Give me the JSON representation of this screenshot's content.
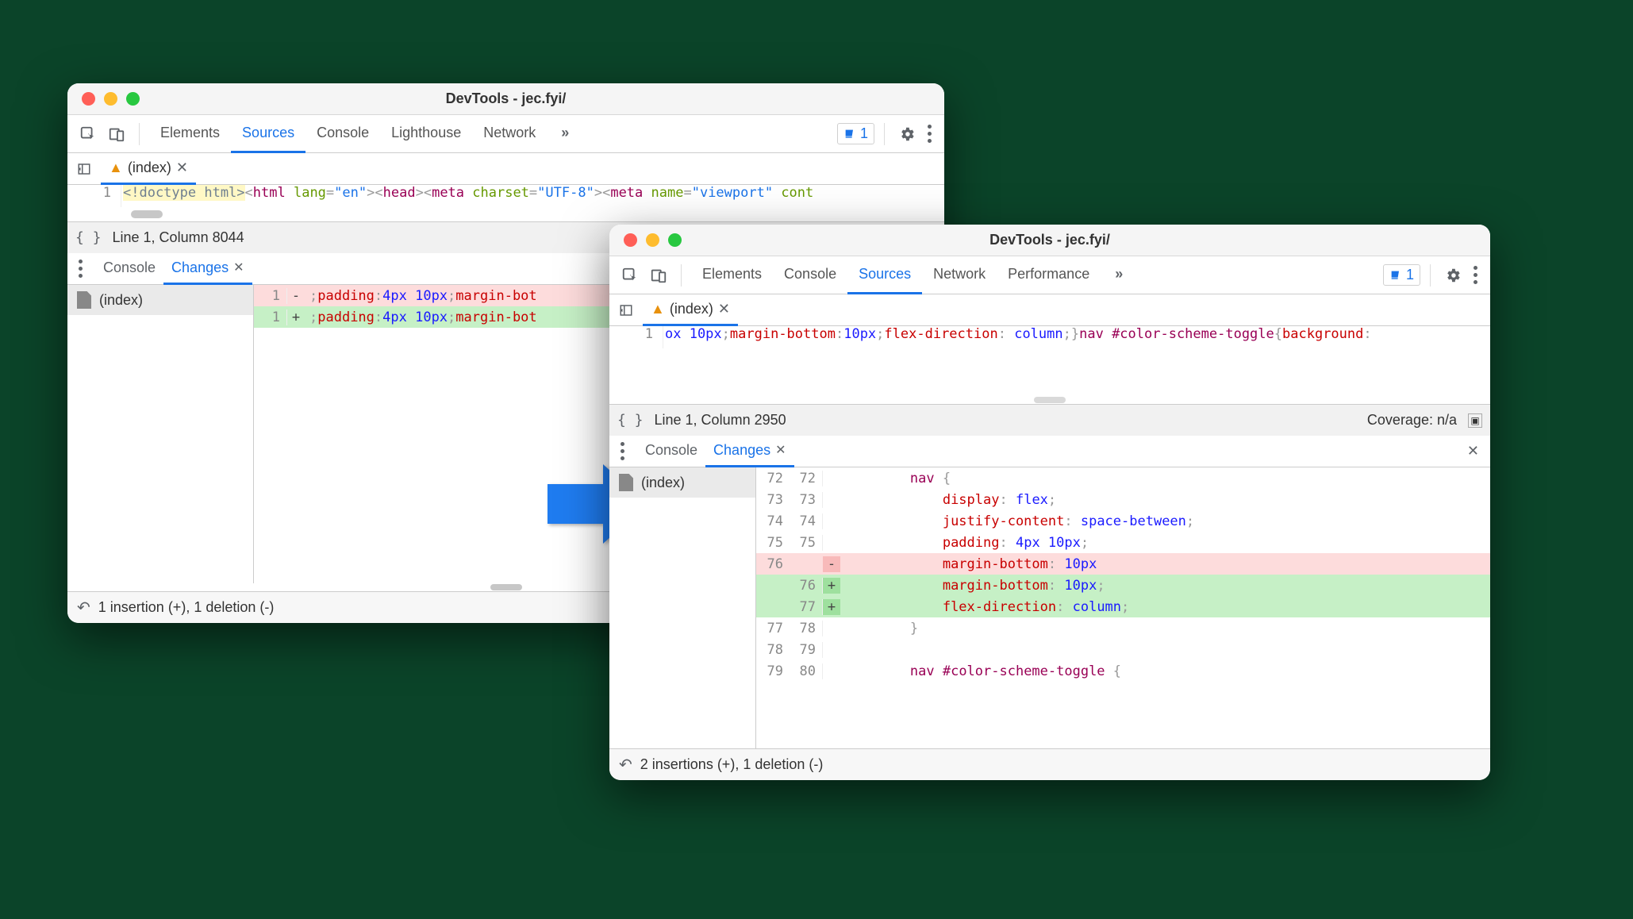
{
  "arrow_color": "#1f7cf0",
  "win1": {
    "title": "DevTools - jec.fyi/",
    "tabs": [
      "Elements",
      "Sources",
      "Console",
      "Lighthouse",
      "Network"
    ],
    "active_tab": 1,
    "more_glyph": "»",
    "issues_count": "1",
    "file_tab": "(index)",
    "code_line_num": "1",
    "code_tokens": [
      {
        "t": "<!doctype html>",
        "cls": "token-doctype hl-yellow"
      },
      {
        "t": "<",
        "cls": "token-punct"
      },
      {
        "t": "html",
        "cls": "token-tag"
      },
      {
        "t": " lang",
        "cls": "token-attrname"
      },
      {
        "t": "=",
        "cls": "token-punct"
      },
      {
        "t": "\"en\"",
        "cls": "token-string"
      },
      {
        "t": ">",
        "cls": "token-punct"
      },
      {
        "t": "<",
        "cls": "token-punct"
      },
      {
        "t": "head",
        "cls": "token-tag"
      },
      {
        "t": ">",
        "cls": "token-punct"
      },
      {
        "t": "<",
        "cls": "token-punct"
      },
      {
        "t": "meta",
        "cls": "token-tag"
      },
      {
        "t": " charset",
        "cls": "token-attrname"
      },
      {
        "t": "=",
        "cls": "token-punct"
      },
      {
        "t": "\"UTF-8\"",
        "cls": "token-string"
      },
      {
        "t": ">",
        "cls": "token-punct"
      },
      {
        "t": "<",
        "cls": "token-punct"
      },
      {
        "t": "meta",
        "cls": "token-tag"
      },
      {
        "t": " name",
        "cls": "token-attrname"
      },
      {
        "t": "=",
        "cls": "token-punct"
      },
      {
        "t": "\"viewport\"",
        "cls": "token-string"
      },
      {
        "t": " cont",
        "cls": "token-attrname"
      }
    ],
    "status": "Line 1, Column 8044",
    "drawer_tabs": [
      "Console",
      "Changes"
    ],
    "drawer_active": 1,
    "changes_file": "(index)",
    "diff": [
      {
        "oldln": "1",
        "newln": "",
        "sign": "-",
        "kind": "del",
        "segs": [
          {
            "t": ";",
            "cls": "token-punct"
          },
          {
            "t": "padding",
            "cls": "token-prop"
          },
          {
            "t": ":",
            "cls": "token-punct"
          },
          {
            "t": "4px 10px",
            "cls": "token-num"
          },
          {
            "t": ";",
            "cls": "token-punct"
          },
          {
            "t": "margin-bot",
            "cls": "token-prop"
          }
        ]
      },
      {
        "oldln": "",
        "newln": "1",
        "sign": "+",
        "kind": "add",
        "segs": [
          {
            "t": ";",
            "cls": "token-punct"
          },
          {
            "t": "padding",
            "cls": "token-prop"
          },
          {
            "t": ":",
            "cls": "token-punct"
          },
          {
            "t": "4px 10px",
            "cls": "token-num"
          },
          {
            "t": ";",
            "cls": "token-punct"
          },
          {
            "t": "margin-bot",
            "cls": "token-prop"
          }
        ]
      }
    ],
    "summary": "1 insertion (+), 1 deletion (-)"
  },
  "win2": {
    "title": "DevTools - jec.fyi/",
    "tabs": [
      "Elements",
      "Console",
      "Sources",
      "Network",
      "Performance"
    ],
    "active_tab": 2,
    "more_glyph": "»",
    "issues_count": "1",
    "file_tab": "(index)",
    "code_line_num": "1",
    "code_tokens": [
      {
        "t": "ox 10px",
        "cls": "token-num"
      },
      {
        "t": ";",
        "cls": "token-punct"
      },
      {
        "t": "margin-bottom",
        "cls": "token-prop"
      },
      {
        "t": ":",
        "cls": "token-punct"
      },
      {
        "t": "10px",
        "cls": "token-num"
      },
      {
        "t": ";",
        "cls": "token-punct"
      },
      {
        "t": "flex-direction",
        "cls": "token-prop"
      },
      {
        "t": ": ",
        "cls": "token-punct"
      },
      {
        "t": "column",
        "cls": "token-num"
      },
      {
        "t": ";}",
        "cls": "token-punct"
      },
      {
        "t": "nav ",
        "cls": "token-sel"
      },
      {
        "t": "#color-scheme-toggle",
        "cls": "token-sel"
      },
      {
        "t": "{",
        "cls": "token-punct"
      },
      {
        "t": "background",
        "cls": "token-prop"
      },
      {
        "t": ":",
        "cls": "token-punct"
      }
    ],
    "status": "Line 1, Column 2950",
    "coverage_label": "Coverage: n/a",
    "drawer_tabs": [
      "Console",
      "Changes"
    ],
    "drawer_active": 1,
    "changes_file": "(index)",
    "diff": [
      {
        "o": "72",
        "n": "72",
        "sign": "",
        "kind": "ctx",
        "segs": [
          {
            "t": "        ",
            "cls": ""
          },
          {
            "t": "nav ",
            "cls": "token-sel"
          },
          {
            "t": "{",
            "cls": "token-punct"
          }
        ]
      },
      {
        "o": "73",
        "n": "73",
        "sign": "",
        "kind": "ctx",
        "segs": [
          {
            "t": "            ",
            "cls": ""
          },
          {
            "t": "display",
            "cls": "token-prop"
          },
          {
            "t": ": ",
            "cls": "token-punct"
          },
          {
            "t": "flex",
            "cls": "token-num"
          },
          {
            "t": ";",
            "cls": "token-punct"
          }
        ]
      },
      {
        "o": "74",
        "n": "74",
        "sign": "",
        "kind": "ctx",
        "segs": [
          {
            "t": "            ",
            "cls": ""
          },
          {
            "t": "justify-content",
            "cls": "token-prop"
          },
          {
            "t": ": ",
            "cls": "token-punct"
          },
          {
            "t": "space-between",
            "cls": "token-num"
          },
          {
            "t": ";",
            "cls": "token-punct"
          }
        ]
      },
      {
        "o": "75",
        "n": "75",
        "sign": "",
        "kind": "ctx",
        "segs": [
          {
            "t": "            ",
            "cls": ""
          },
          {
            "t": "padding",
            "cls": "token-prop"
          },
          {
            "t": ": ",
            "cls": "token-punct"
          },
          {
            "t": "4px 10px",
            "cls": "token-num"
          },
          {
            "t": ";",
            "cls": "token-punct"
          }
        ]
      },
      {
        "o": "76",
        "n": "",
        "sign": "-",
        "kind": "del",
        "segs": [
          {
            "t": "            ",
            "cls": ""
          },
          {
            "t": "margin-bottom",
            "cls": "token-prop"
          },
          {
            "t": ": ",
            "cls": "token-punct"
          },
          {
            "t": "10px",
            "cls": "token-num"
          }
        ]
      },
      {
        "o": "",
        "n": "76",
        "sign": "+",
        "kind": "add",
        "segs": [
          {
            "t": "            ",
            "cls": ""
          },
          {
            "t": "margin-bottom",
            "cls": "token-prop"
          },
          {
            "t": ": ",
            "cls": "token-punct"
          },
          {
            "t": "10px",
            "cls": "token-num"
          },
          {
            "t": ";",
            "cls": "token-punct"
          }
        ]
      },
      {
        "o": "",
        "n": "77",
        "sign": "+",
        "kind": "add",
        "segs": [
          {
            "t": "            ",
            "cls": ""
          },
          {
            "t": "flex-direction",
            "cls": "token-prop"
          },
          {
            "t": ": ",
            "cls": "token-punct"
          },
          {
            "t": "column",
            "cls": "token-num"
          },
          {
            "t": ";",
            "cls": "token-punct"
          }
        ]
      },
      {
        "o": "77",
        "n": "78",
        "sign": "",
        "kind": "ctx",
        "segs": [
          {
            "t": "        }",
            "cls": "token-punct"
          }
        ]
      },
      {
        "o": "78",
        "n": "79",
        "sign": "",
        "kind": "ctx",
        "segs": [
          {
            "t": "",
            "cls": ""
          }
        ]
      },
      {
        "o": "79",
        "n": "80",
        "sign": "",
        "kind": "ctx",
        "segs": [
          {
            "t": "        ",
            "cls": ""
          },
          {
            "t": "nav ",
            "cls": "token-sel"
          },
          {
            "t": "#color-scheme-toggle ",
            "cls": "token-sel"
          },
          {
            "t": "{",
            "cls": "token-punct"
          }
        ]
      }
    ],
    "summary": "2 insertions (+), 1 deletion (-)"
  }
}
